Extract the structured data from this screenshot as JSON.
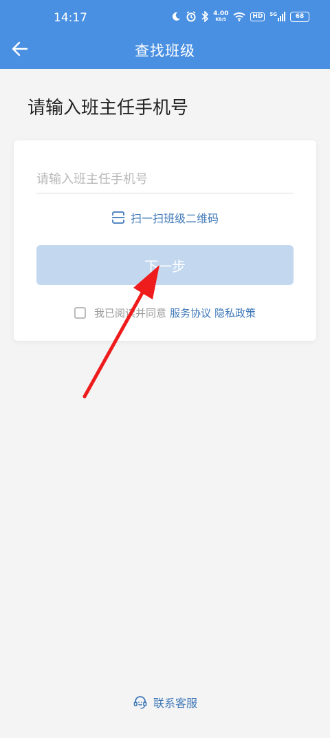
{
  "status_bar": {
    "time": "14:17",
    "net_speed_value": "4.00",
    "net_speed_unit": "KB/S",
    "hd": "HD",
    "signal": "5G",
    "battery": "68"
  },
  "header": {
    "title": "查找班级",
    "bg_color": "#4a90e2"
  },
  "main": {
    "heading": "请输入班主任手机号",
    "phone_input": {
      "value": "",
      "placeholder": "请输入班主任手机号"
    },
    "scan_label": "扫一扫班级二维码",
    "next_label": "下一步",
    "agreement": {
      "checked": false,
      "prefix": "我已阅读并同意",
      "service": "服务协议",
      "privacy": "隐私政策"
    }
  },
  "footer": {
    "contact_label": "联系客服"
  },
  "icons": [
    "back-arrow-icon",
    "scan-icon",
    "headset-icon",
    "moon-icon",
    "alarm-icon",
    "bluetooth-icon",
    "wifi-icon",
    "signal-icon",
    "battery-icon"
  ]
}
